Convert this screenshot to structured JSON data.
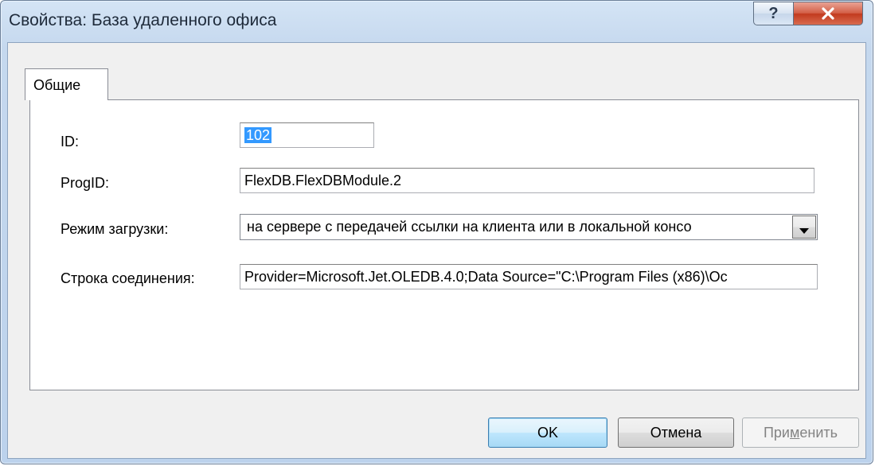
{
  "window": {
    "title": "Свойства: База удаленного офиса"
  },
  "titlebar_buttons": {
    "help_glyph": "?",
    "close_glyph": "X"
  },
  "tabs": [
    {
      "label": "Общие",
      "selected": true
    }
  ],
  "form": {
    "id_label": "ID:",
    "id_value": "102",
    "progid_label": "ProgID:",
    "progid_value": "FlexDB.FlexDBModule.2",
    "load_mode_label": "Режим загрузки:",
    "load_mode_value": "на сервере с передачей ссылки на клиента или в локальной консо",
    "connection_label": "Строка соединения:",
    "connection_value": "Provider=Microsoft.Jet.OLEDB.4.0;Data Source=\"C:\\Program Files (x86)\\Oc"
  },
  "buttons": {
    "ok_label": "OK",
    "cancel_label": "Отмена",
    "apply_label_pre": "При",
    "apply_label_mnemonic": "м",
    "apply_label_post": "енить"
  },
  "colors": {
    "selection": "#3399ff",
    "close_button": "#c23a1e",
    "disabled_text": "#838383"
  }
}
